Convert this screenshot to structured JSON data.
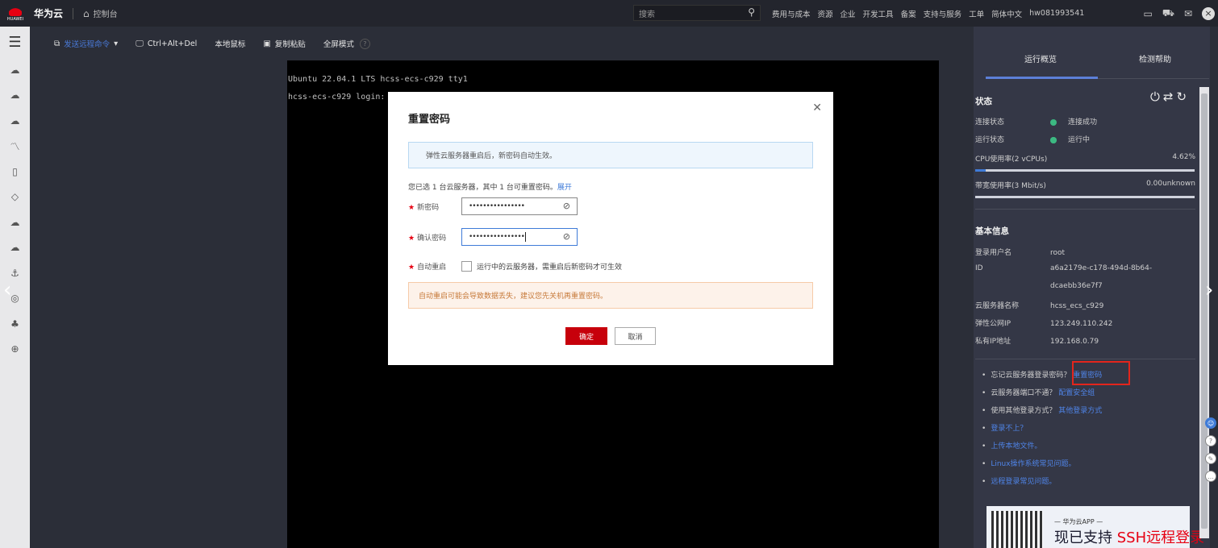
{
  "topbar": {
    "logo_text": "HUAWEI",
    "brand": "华为云",
    "console": "控制台",
    "search_placeholder": "搜索",
    "nav": [
      "费用与成本",
      "资源",
      "企业",
      "开发工具",
      "备案",
      "支持与服务",
      "工单",
      "简体中文",
      "hw081993541"
    ]
  },
  "toolbar": {
    "send_command": "发送远程命令",
    "ctrl_alt_del": "Ctrl+Alt+Del",
    "local_mouse": "本地鼠标",
    "copy_paste": "复制粘贴",
    "fullscreen": "全屏模式"
  },
  "terminal": {
    "line1": "Ubuntu 22.04.1 LTS hcss-ecs-c929 tty1",
    "line2": "hcss-ecs-c929 login:"
  },
  "modal": {
    "title": "重置密码",
    "info": "弹性云服务器重启后，新密码自动生效。",
    "selected_text": "您已选 1 台云服务器，其中 1 台可重置密码。",
    "expand": "展开",
    "new_password_label": "新密码",
    "new_password_value": "••••••••••••••••",
    "confirm_password_label": "确认密码",
    "confirm_password_value": "••••••••••••••••",
    "auto_restart_label": "自动重启",
    "auto_restart_text": "运行中的云服务器，需重启后新密码才可生效",
    "warning": "自动重启可能会导致数据丢失，建议您先关机再重置密码。",
    "ok": "确定",
    "cancel": "取消"
  },
  "right_panel": {
    "tab_overview": "运行概览",
    "tab_help": "检测帮助",
    "status_title": "状态",
    "conn_label": "连接状态",
    "conn_value": "连接成功",
    "run_label": "运行状态",
    "run_value": "运行中",
    "cpu_label": "CPU使用率(2 vCPUs)",
    "cpu_value": "4.62%",
    "cpu_percent": 4.62,
    "bw_label": "带宽使用率(3 Mbit/s)",
    "bw_value": "0.00unknown",
    "bw_percent": 0,
    "basic_title": "基本信息",
    "user_label": "登录用户名",
    "user_value": "root",
    "id_label": "ID",
    "id_value_1": "a6a2179e-c178-494d-8b64-",
    "id_value_2": "dcaebb36e7f7",
    "name_label": "云服务器名称",
    "name_value": "hcss_ecs_c929",
    "eip_label": "弹性公网IP",
    "eip_value": "123.249.110.242",
    "pip_label": "私有IP地址",
    "pip_value": "192.168.0.79",
    "tips": [
      {
        "q": "忘记云服务器登录密码？",
        "link": "重置密码"
      },
      {
        "q": "云服务器端口不通？",
        "link": "配置安全组"
      },
      {
        "q": "使用其他登录方式？",
        "link": "其他登录方式"
      },
      {
        "q": "",
        "link": "登录不上？"
      },
      {
        "q": "",
        "link": "上传本地文件。"
      },
      {
        "q": "",
        "link": "Linux操作系统常见问题。"
      },
      {
        "q": "",
        "link": "远程登录常见问题。"
      }
    ],
    "qr_app": "— 华为云APP —",
    "qr_promo_a": "现已支持 ",
    "qr_promo_b": "SSH远程登录"
  }
}
